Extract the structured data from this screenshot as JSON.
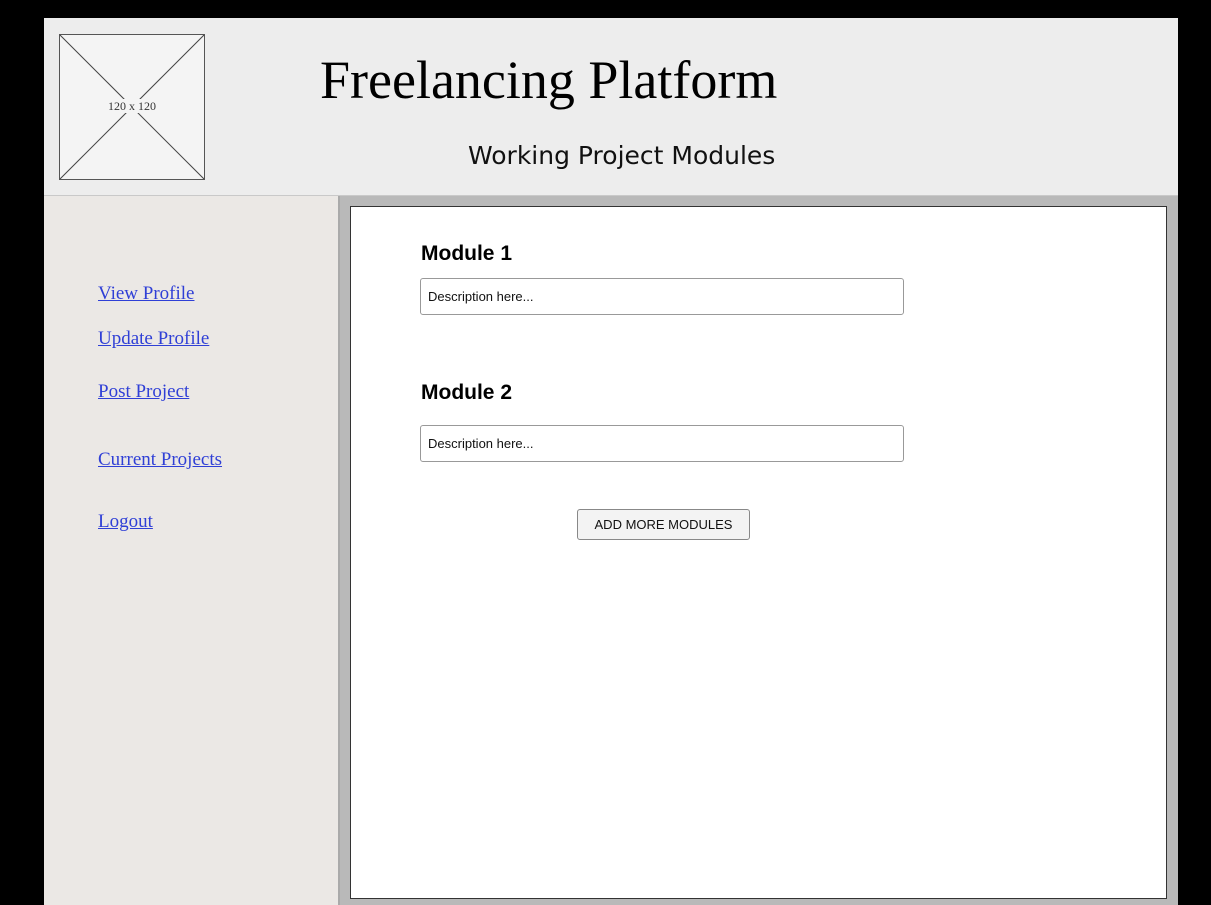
{
  "header": {
    "logo_placeholder_text": "120 x 120",
    "app_title": "Freelancing Platform",
    "page_subtitle": "Working Project Modules"
  },
  "sidebar": {
    "links": [
      {
        "label": "View Profile"
      },
      {
        "label": "Update Profile"
      },
      {
        "label": "Post Project"
      },
      {
        "label": "Current Projects"
      },
      {
        "label": "Logout"
      }
    ]
  },
  "main": {
    "modules": [
      {
        "heading": "Module 1",
        "placeholder": "Description here..."
      },
      {
        "heading": "Module 2",
        "placeholder": "Description here..."
      }
    ],
    "add_button_label": "ADD MORE MODULES"
  },
  "colors": {
    "background": "#000000",
    "header_bg": "#ededed",
    "sidebar_bg": "#ebe8e5",
    "link": "#2f3fd6",
    "content_bg": "#ffffff"
  }
}
